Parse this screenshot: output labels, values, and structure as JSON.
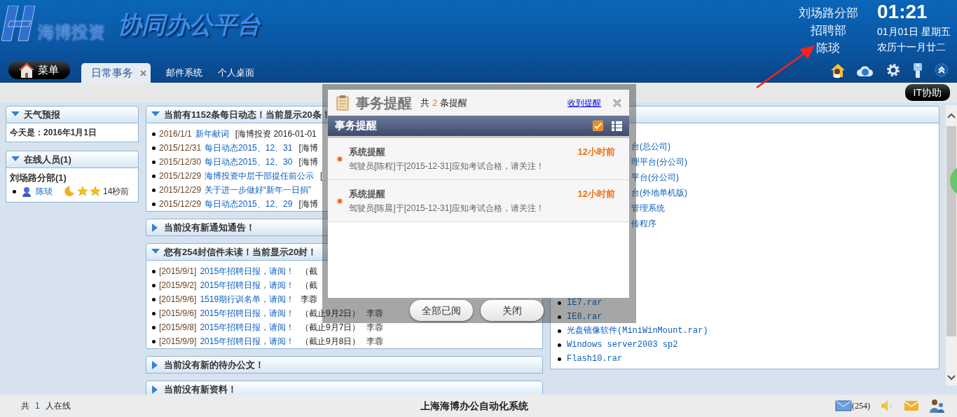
{
  "header": {
    "logo_company": "海博投资",
    "platform_title": "协同办公平台",
    "user": {
      "branch": "刘场路分部",
      "department": "招聘部",
      "name": "陈琰"
    },
    "clock": {
      "time": "01:21",
      "date": "01月01日 星期五",
      "lunar": "农历十一月廿二"
    }
  },
  "menu_button": "菜单",
  "tabs": [
    {
      "label": "日常事务",
      "selected": true,
      "closable": true
    },
    {
      "label": "邮件系统",
      "selected": false,
      "closable": false
    },
    {
      "label": "个人桌面",
      "selected": false,
      "closable": false
    }
  ],
  "it_help_button": "IT协助",
  "left_panels": [
    {
      "kind": "weather",
      "title": "天气预报",
      "expanded": true,
      "text": "今天是：2016年1月1日"
    },
    {
      "kind": "online",
      "title": "在线人员(1)",
      "expanded": true,
      "group": "刘场路分部(1)",
      "users": [
        {
          "name": "陈琰",
          "last_seen": "14秒前"
        }
      ]
    }
  ],
  "main_panels": [
    {
      "title": "当前有1152条每日动态！当前显示20条！",
      "expanded": true,
      "rows": [
        {
          "date": "2016/1/1",
          "title": "新年献词",
          "note": "[海博投资 2016-01-01"
        },
        {
          "date": "2015/12/31",
          "title": "每日动态2015、12、31",
          "note": "[海博"
        },
        {
          "date": "2015/12/30",
          "title": "每日动态2015、12、30",
          "note": "[海博"
        },
        {
          "date": "2015/12/29",
          "title": "海博投资中层干部提任前公示",
          "note": "["
        },
        {
          "date": "2015/12/29",
          "title": "关于进一步做好“新年一日捐”"
        },
        {
          "date": "2015/12/29",
          "title": "每日动态2015、12、29",
          "note": "[海博"
        }
      ]
    },
    {
      "title": "当前没有新通知通告！",
      "expanded": false
    },
    {
      "title": "您有254封信件未读！当前显示20封！",
      "expanded": true,
      "rows": [
        {
          "date": "[2015/9/1]",
          "title": "2015年招聘日报，请阅！",
          "note": "（截"
        },
        {
          "date": "[2015/9/2]",
          "title": "2015年招聘日报，请阅！",
          "note": "（截"
        },
        {
          "date": "[2015/9/6]",
          "title": "1519期行训名单，请阅！",
          "note": "李蓉"
        },
        {
          "date": "[2015/9/6]",
          "title": "2015年招聘日报，请阅！",
          "note": "（截止9月2日）",
          "author": "李蓉"
        },
        {
          "date": "[2015/9/8]",
          "title": "2015年招聘日报，请阅！",
          "note": "（截止9月7日）",
          "author": "李蓉"
        },
        {
          "date": "[2015/9/9]",
          "title": "2015年招聘日报，请阅！",
          "note": "（截止9月8日）",
          "author": "李蓉"
        }
      ]
    },
    {
      "title": "当前没有新的待办公文！",
      "expanded": false
    },
    {
      "title": "当前没有新资料！",
      "expanded": false
    }
  ],
  "right_panel": {
    "links": [
      {
        "text": "台(总公司)",
        "clipped": true
      },
      {
        "text": "理平台(分公司)",
        "clipped": true
      },
      {
        "text": "平台(分公司)",
        "clipped": true
      },
      {
        "text": "台(外地单机版)",
        "clipped": true
      },
      {
        "text": "管理系统",
        "clipped": true
      },
      {
        "text": "传程序",
        "clipped": true
      },
      {
        "text": "IE7.rar",
        "clipped": false
      },
      {
        "text": "IE8.rar",
        "clipped": false
      },
      {
        "text": "光盘镜像软件(MiniWinMount.rar)",
        "clipped": false
      },
      {
        "text": "Windows server2003 sp2",
        "clipped": false
      },
      {
        "text": "Flash10.rar",
        "clipped": false
      }
    ]
  },
  "reminder_dialog": {
    "title": "事务提醒",
    "count_prefix": "共",
    "count": "2",
    "count_suffix": "条提醒",
    "received_link": "收到提醒",
    "section_title": "事务提醒",
    "select_all_checked": true,
    "items": [
      {
        "title": "系统提醒",
        "time": "12小时前",
        "message": "驾驶员[陈程]于[2015-12-31]应知考试合格，请关注！"
      },
      {
        "title": "系统提醒",
        "time": "12小时前",
        "message": "驾驶员[陈晨]于[2015-12-31]应知考试合格，请关注！"
      }
    ],
    "buttons": [
      "全部已阅",
      "关闭"
    ]
  },
  "status_bar": {
    "online_prefix": "共",
    "online_count": "1",
    "online_suffix": "人在线",
    "system_name": "上海海博办公自动化系统",
    "mail_count": "(254)"
  }
}
